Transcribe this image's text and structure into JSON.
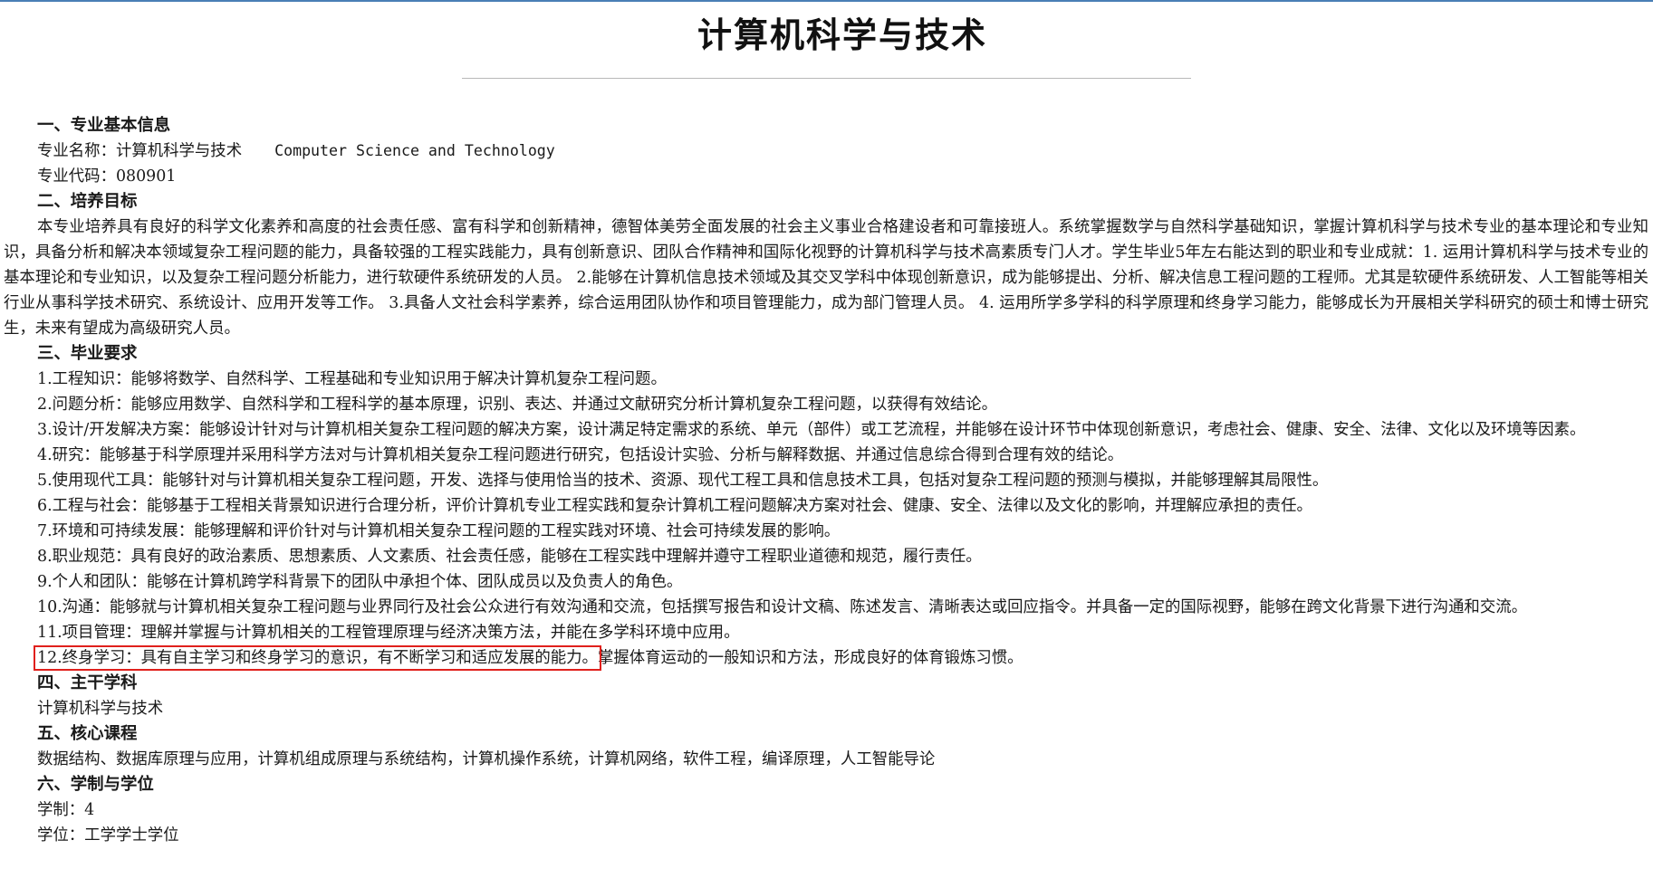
{
  "page": {
    "title": "计算机科学与技术"
  },
  "sections": {
    "basic": {
      "heading": "一、专业基本信息",
      "name_label": "专业名称：计算机科学与技术",
      "name_en": "Computer Science and Technology",
      "code_label": "专业代码：080901"
    },
    "goal": {
      "heading": "二、培养目标",
      "text": "本专业培养具有良好的科学文化素养和高度的社会责任感、富有科学和创新精神，德智体美劳全面发展的社会主义事业合格建设者和可靠接班人。系统掌握数学与自然科学基础知识，掌握计算机科学与技术专业的基本理论和专业知识，具备分析和解决本领域复杂工程问题的能力，具备较强的工程实践能力，具有创新意识、团队合作精神和国际化视野的计算机科学与技术高素质专门人才。学生毕业5年左右能达到的职业和专业成就：1. 运用计算机科学与技术专业的基本理论和专业知识，以及复杂工程问题分析能力，进行软硬件系统研发的人员。 2.能够在计算机信息技术领域及其交叉学科中体现创新意识，成为能够提出、分析、解决信息工程问题的工程师。尤其是软硬件系统研发、人工智能等相关行业从事科学技术研究、系统设计、应用开发等工作。 3.具备人文社会科学素养，综合运用团队协作和项目管理能力，成为部门管理人员。 4. 运用所学多学科的科学原理和终身学习能力，能够成长为开展相关学科研究的硕士和博士研究生，未来有望成为高级研究人员。"
    },
    "requirements": {
      "heading": "三、毕业要求",
      "items": [
        "1.工程知识：能够将数学、自然科学、工程基础和专业知识用于解决计算机复杂工程问题。",
        "2.问题分析：能够应用数学、自然科学和工程科学的基本原理，识别、表达、并通过文献研究分析计算机复杂工程问题，以获得有效结论。",
        "3.设计/开发解决方案：能够设计针对与计算机相关复杂工程问题的解决方案，设计满足特定需求的系统、单元（部件）或工艺流程，并能够在设计环节中体现创新意识，考虑社会、健康、安全、法律、文化以及环境等因素。",
        "4.研究：能够基于科学原理并采用科学方法对与计算机相关复杂工程问题进行研究，包括设计实验、分析与解释数据、并通过信息综合得到合理有效的结论。",
        "5.使用现代工具：能够针对与计算机相关复杂工程问题，开发、选择与使用恰当的技术、资源、现代工程工具和信息技术工具，包括对复杂工程问题的预测与模拟，并能够理解其局限性。",
        "6.工程与社会：能够基于工程相关背景知识进行合理分析，评价计算机专业工程实践和复杂计算机工程问题解决方案对社会、健康、安全、法律以及文化的影响，并理解应承担的责任。",
        "7.环境和可持续发展：能够理解和评价针对与计算机相关复杂工程问题的工程实践对环境、社会可持续发展的影响。",
        "8.职业规范：具有良好的政治素质、思想素质、人文素质、社会责任感，能够在工程实践中理解并遵守工程职业道德和规范，履行责任。",
        "9.个人和团队：能够在计算机跨学科背景下的团队中承担个体、团队成员以及负责人的角色。",
        "10.沟通：能够就与计算机相关复杂工程问题与业界同行及社会公众进行有效沟通和交流，包括撰写报告和设计文稿、陈述发言、清晰表达或回应指令。并具备一定的国际视野，能够在跨文化背景下进行沟通和交流。",
        "11.项目管理：理解并掌握与计算机相关的工程管理原理与经济决策方法，并能在多学科环境中应用。"
      ],
      "item12_highlighted": "12.终身学习：具有自主学习和终身学习的意识，有不断学习和适应发展的能力。",
      "item12_rest": "掌握体育运动的一般知识和方法，形成良好的体育锻炼习惯。"
    },
    "discipline": {
      "heading": "四、主干学科",
      "text": "计算机科学与技术"
    },
    "courses": {
      "heading": "五、核心课程",
      "text": "数据结构、数据库原理与应用，计算机组成原理与系统结构，计算机操作系统，计算机网络，软件工程，编译原理，人工智能导论"
    },
    "degree": {
      "heading": "六、学制与学位",
      "duration": "学制：4",
      "degree": "学位：工学学士学位"
    }
  },
  "colors": {
    "highlight_border": "#e0201c",
    "top_border": "#4a7fb5"
  }
}
